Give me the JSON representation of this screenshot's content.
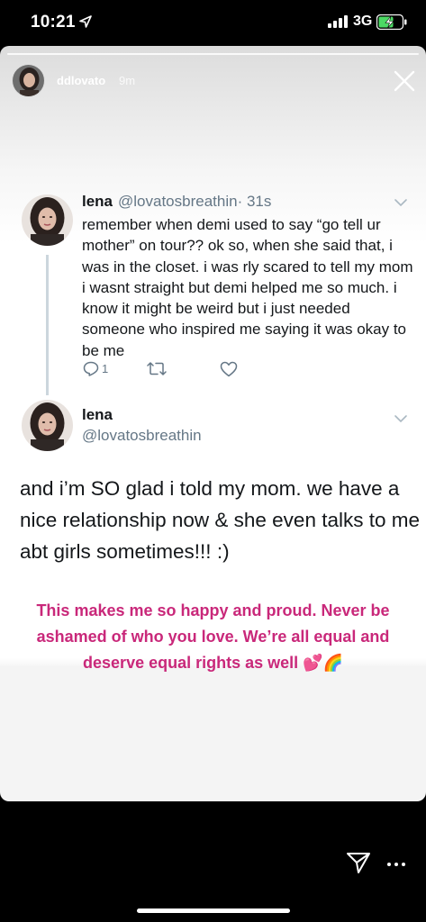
{
  "status_bar": {
    "time": "10:21",
    "network": "3G",
    "icons": [
      "location-arrow-icon",
      "signal-icon",
      "battery-charging-icon"
    ]
  },
  "story": {
    "username": "ddlovato",
    "age": "9m",
    "progress": 1.0,
    "close_icon": "close-icon"
  },
  "tweets": [
    {
      "name": "lena",
      "handle": "@lovatosbreathin",
      "time": "· 31s",
      "text": "remember when demi used to say “go tell ur mother” on tour?? ok so, when she said that, i was in the closet. i was rly scared to tell my mom i wasnt straight but demi helped me so much. i know it might be weird but i just needed someone who inspired me saying it was okay to be me",
      "reply_count": "1"
    },
    {
      "name": "lena",
      "handle": "@lovatosbreathin",
      "text": "and i’m SO glad i told my mom. we have a nice relationship now & she even talks to me abt girls sometimes!!! :)"
    }
  ],
  "caption": {
    "text": "This makes me so happy and proud. Never be ashamed of who you love. We’re all equal and deserve equal rights as well 💕🌈",
    "color": "#c9287a"
  },
  "colors": {
    "twitter_gray": "#657786",
    "twitter_text": "#14171a",
    "thread_line": "#ccd6dd"
  }
}
